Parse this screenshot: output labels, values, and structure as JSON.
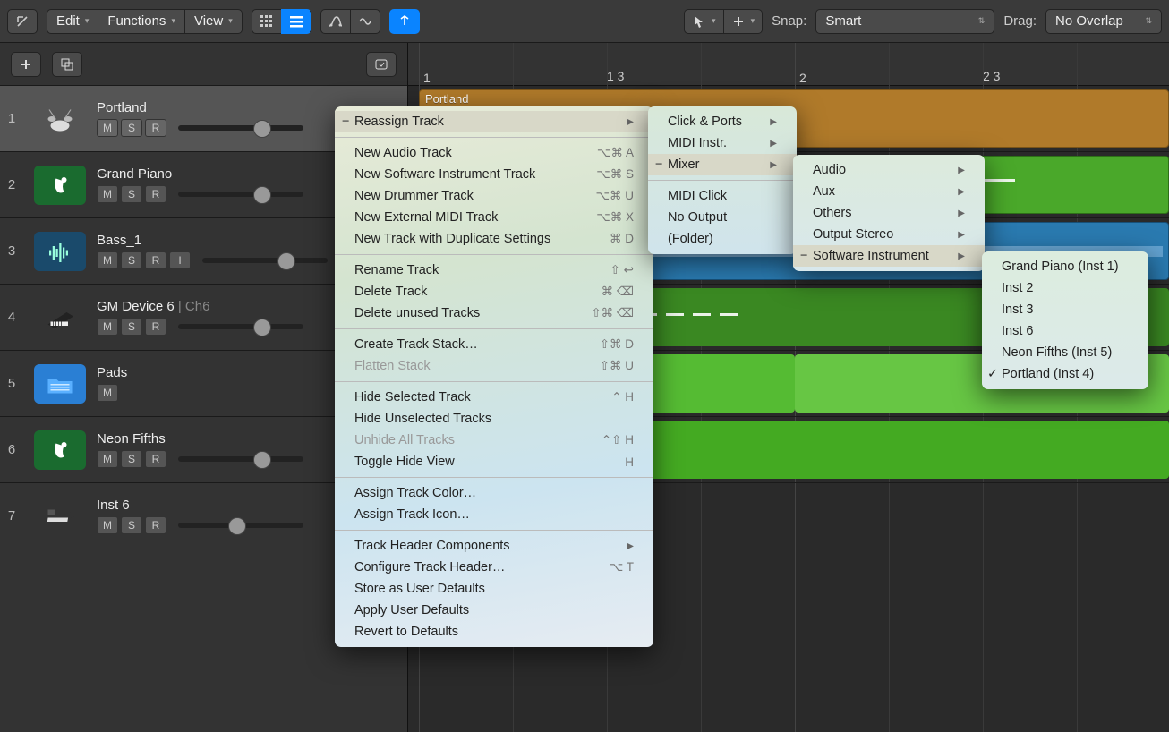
{
  "toolbar": {
    "edit": "Edit",
    "functions": "Functions",
    "view": "View",
    "snap_label": "Snap:",
    "snap_value": "Smart",
    "drag_label": "Drag:",
    "drag_value": "No Overlap"
  },
  "ruler": {
    "marks": [
      "1",
      "1 3",
      "2",
      "2 3"
    ]
  },
  "tracks": [
    {
      "num": "1",
      "name": "Portland",
      "suffix": "",
      "msr": [
        "M",
        "S",
        "R"
      ],
      "icon": "drumkit",
      "selected": true,
      "vol": "mid"
    },
    {
      "num": "2",
      "name": "Grand Piano",
      "suffix": "",
      "msr": [
        "M",
        "S",
        "R"
      ],
      "icon": "swinst",
      "vol": "mid"
    },
    {
      "num": "3",
      "name": "Bass_1",
      "suffix": "",
      "msr": [
        "M",
        "S",
        "R",
        "I"
      ],
      "icon": "audio",
      "vol": "mid"
    },
    {
      "num": "4",
      "name": "GM Device 6",
      "suffix": " | Ch6",
      "msr": [
        "M",
        "S",
        "R"
      ],
      "icon": "piano",
      "vol": "mid"
    },
    {
      "num": "5",
      "name": "Pads",
      "suffix": "",
      "msr": [
        "M"
      ],
      "icon": "folder",
      "vol": ""
    },
    {
      "num": "6",
      "name": "Neon Fifths",
      "suffix": "",
      "msr": [
        "M",
        "S",
        "R"
      ],
      "icon": "swinst",
      "vol": "mid"
    },
    {
      "num": "7",
      "name": "Inst 6",
      "suffix": "",
      "msr": [
        "M",
        "S",
        "R"
      ],
      "icon": "keyboard",
      "vol": "low"
    }
  ],
  "regions": {
    "portland_label": "Portland"
  },
  "context_menu": {
    "reassign_track": "Reassign Track",
    "new_audio": "New Audio Track",
    "new_audio_sc": "⌥⌘ A",
    "new_sw": "New Software Instrument Track",
    "new_sw_sc": "⌥⌘ S",
    "new_drummer": "New Drummer Track",
    "new_drummer_sc": "⌥⌘ U",
    "new_ext": "New External MIDI Track",
    "new_ext_sc": "⌥⌘ X",
    "new_dup": "New Track with Duplicate Settings",
    "new_dup_sc": "⌘ D",
    "rename": "Rename Track",
    "rename_sc": "⇧ ↩",
    "delete": "Delete Track",
    "delete_sc": "⌘ ⌫",
    "delete_unused": "Delete unused Tracks",
    "delete_unused_sc": "⇧⌘ ⌫",
    "create_stack": "Create Track Stack…",
    "create_stack_sc": "⇧⌘ D",
    "flatten": "Flatten Stack",
    "flatten_sc": "⇧⌘ U",
    "hide_sel": "Hide Selected Track",
    "hide_sel_sc": "⌃ H",
    "hide_unsel": "Hide Unselected Tracks",
    "unhide": "Unhide All Tracks",
    "unhide_sc": "⌃⇧ H",
    "toggle_hide": "Toggle Hide View",
    "toggle_hide_sc": "H",
    "assign_color": "Assign Track Color…",
    "assign_icon": "Assign Track Icon…",
    "header_comp": "Track Header Components",
    "configure": "Configure Track Header…",
    "configure_sc": "⌥ T",
    "store_def": "Store as User Defaults",
    "apply_def": "Apply User Defaults",
    "revert_def": "Revert to Defaults"
  },
  "submenu1": {
    "click_ports": "Click & Ports",
    "midi_instr": "MIDI Instr.",
    "mixer": "Mixer",
    "midi_click": "MIDI Click",
    "no_output": "No Output",
    "folder": "(Folder)"
  },
  "submenu2": {
    "audio": "Audio",
    "aux": "Aux",
    "others": "Others",
    "output_stereo": "Output Stereo",
    "sw_inst": "Software Instrument"
  },
  "submenu3": {
    "items": [
      {
        "label": "Grand Piano (Inst 1)",
        "checked": false
      },
      {
        "label": "Inst 2",
        "checked": false
      },
      {
        "label": "Inst 3",
        "checked": false
      },
      {
        "label": "Inst 6",
        "checked": false
      },
      {
        "label": "Neon Fifths (Inst 5)",
        "checked": false
      },
      {
        "label": "Portland (Inst 4)",
        "checked": true
      }
    ]
  }
}
